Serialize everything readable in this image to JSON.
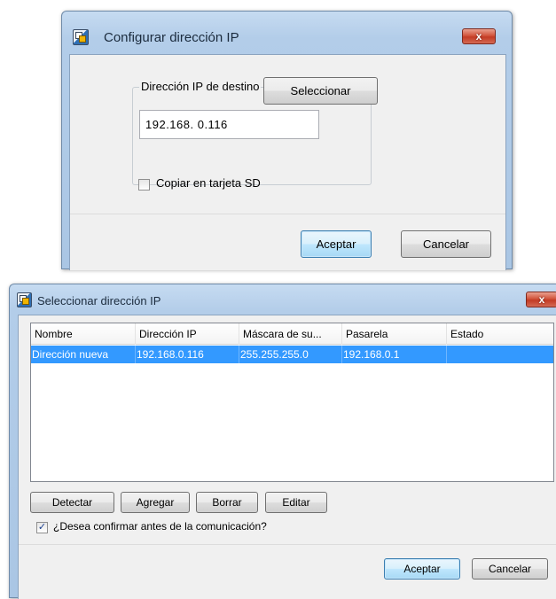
{
  "dialog_config": {
    "title": "Configurar dirección IP",
    "group_label": "Dirección IP de destino",
    "ip_value": "192.168.  0.116",
    "select_label": "Seleccionar",
    "sd_checkbox_label": "Copiar en tarjeta SD",
    "sd_checked": false,
    "ok_label": "Aceptar",
    "cancel_label": "Cancelar",
    "close_label": "x"
  },
  "dialog_select": {
    "title": "Seleccionar dirección IP",
    "close_label": "x",
    "table": {
      "columns": [
        "Nombre",
        "Dirección IP",
        "Máscara de su...",
        "Pasarela",
        "Estado"
      ],
      "rows": [
        [
          "Dirección nueva",
          "192.168.0.116",
          "255.255.255.0",
          "192.168.0.1",
          ""
        ]
      ],
      "selected_row": 0
    },
    "buttons": {
      "detect": "Detectar",
      "add": "Agregar",
      "delete": "Borrar",
      "edit": "Editar"
    },
    "confirm_label": "¿Desea confirmar antes de la comunicación?",
    "confirm_checked": true,
    "ok_label": "Aceptar",
    "cancel_label": "Cancelar"
  }
}
